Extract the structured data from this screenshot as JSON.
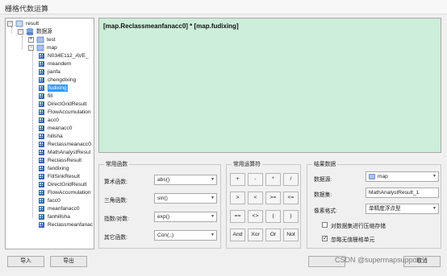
{
  "window": {
    "title": "栅格代数运算"
  },
  "tree": {
    "root": "result",
    "datasource": "数据源",
    "ds_test": "test",
    "ds_map": "map",
    "layers": [
      "N034E112_AVE_",
      "meandem",
      "jianfa",
      "chengdixing",
      "fudixing",
      "fill",
      "DirectGridResult",
      "FlowAccumulation",
      "acc0",
      "meanacc0",
      "hillsha",
      "Reclassmeanacc0",
      "MathAnalystResul",
      "ReclassResult",
      "fandixing",
      "FillSinkResult",
      "DirectGridResult",
      "FlowAccumulation",
      "facc0",
      "meanfanacc0",
      "fanhillsha",
      "Reclassmeanfanac"
    ],
    "selected_index": 4
  },
  "buttons": {
    "import": "导入",
    "export": "导出",
    "cancel": "取消"
  },
  "expression": "[map.Reclassmeanfanacc0] * [map.fudixing]",
  "functions": {
    "title": "常用函数",
    "rows": [
      {
        "label": "算术函数:",
        "value": "abs()"
      },
      {
        "label": "三角函数:",
        "value": "sin()"
      },
      {
        "label": "指数/对数:",
        "value": "exp()"
      },
      {
        "label": "其它函数:",
        "value": "Con(,,)"
      }
    ]
  },
  "operators": {
    "title": "常用运算符",
    "rows": [
      [
        "+",
        "-",
        "*",
        "/"
      ],
      [
        ">",
        "<",
        ">=",
        "<="
      ],
      [
        "==",
        "<>",
        "(",
        ")"
      ],
      [
        "And",
        "Xor",
        "Or",
        "Not"
      ]
    ]
  },
  "result": {
    "title": "结果数据",
    "datasource_label": "数据源:",
    "datasource_value": "map",
    "dataset_label": "数据集:",
    "dataset_value": "MathAnalystResult_1",
    "pixel_label": "像素格式:",
    "pixel_value": "单精度浮点型",
    "compress_label": "对数据集进行压缩存储",
    "compress_checked": false,
    "ignore_label": "忽略无值栅格单元",
    "ignore_checked": true
  },
  "watermark": "CSDN @supermapsupport"
}
